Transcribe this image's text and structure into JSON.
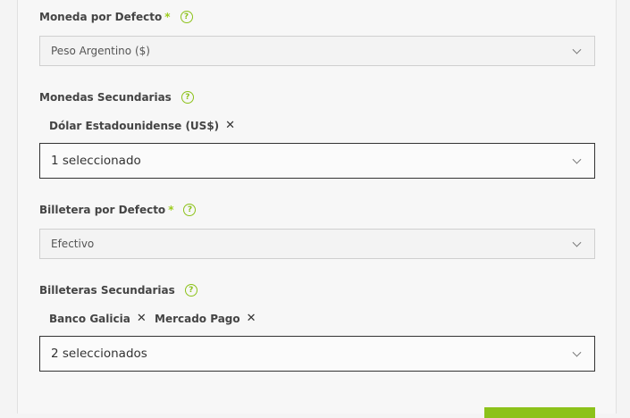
{
  "default_currency": {
    "label": "Moneda por Defecto",
    "required_mark": "*",
    "value": "Peso Argentino ($)"
  },
  "secondary_currencies": {
    "label": "Monedas Secundarias",
    "tags": [
      {
        "label": "Dólar Estadounidense (US$)",
        "remove": "✕"
      }
    ],
    "value": "1 seleccionado"
  },
  "default_wallet": {
    "label": "Billetera por Defecto",
    "required_mark": "*",
    "value": "Efectivo"
  },
  "secondary_wallets": {
    "label": "Billeteras Secundarias",
    "tags": [
      {
        "label": "Banco Galicia",
        "remove": "✕"
      },
      {
        "label": "Mercado Pago",
        "remove": "✕"
      }
    ],
    "value": "2 seleccionados"
  },
  "help_icon_glyph": "?",
  "colors": {
    "accent": "#8cc21a",
    "required": "#9ccc1c"
  }
}
